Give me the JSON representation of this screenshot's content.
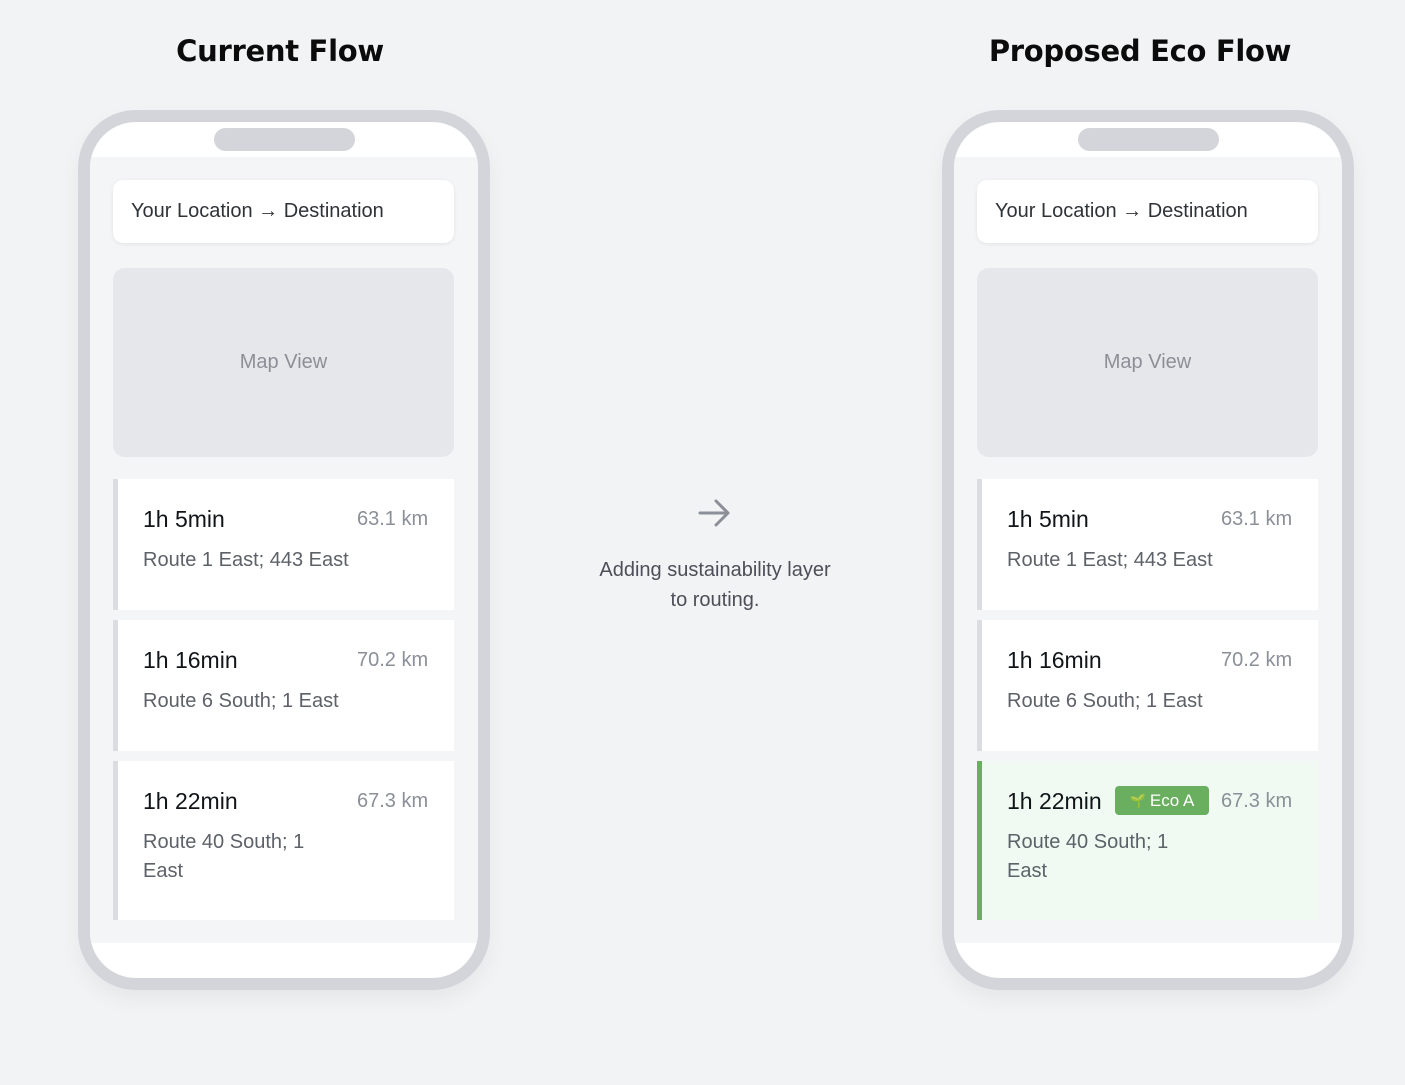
{
  "current_flow": {
    "title": "Current Flow",
    "search_text": "Your Location → Destination",
    "map_label": "Map View",
    "routes": [
      {
        "time": "1h 5min",
        "distance": "63.1 km",
        "description": "Route 1 East; 443 East"
      },
      {
        "time": "1h 16min",
        "distance": "70.2 km",
        "description": "Route 6 South; 1 East"
      },
      {
        "time": "1h 22min",
        "distance": "67.3 km",
        "description": "Route 40 South; 1 East"
      }
    ]
  },
  "proposed_flow": {
    "title": "Proposed Eco Flow",
    "search_text": "Your Location → Destination",
    "map_label": "Map View",
    "routes": [
      {
        "time": "1h 5min",
        "distance": "63.1 km",
        "description": "Route 1 East; 443 East"
      },
      {
        "time": "1h 16min",
        "distance": "70.2 km",
        "description": "Route 6 South; 1 East"
      },
      {
        "time": "1h 22min",
        "distance": "67.3 km",
        "description": "Route 40 South; 1 East",
        "badge": "Eco A",
        "badge_icon": "leaf-icon"
      }
    ]
  },
  "transition": {
    "icon": "arrow-right-icon",
    "caption_line1": "Adding sustainability layer",
    "caption_line2": "to routing."
  },
  "colors": {
    "eco_green": "#6aae5f",
    "eco_background": "#f1faf2",
    "phone_frame": "#d4d5da"
  }
}
